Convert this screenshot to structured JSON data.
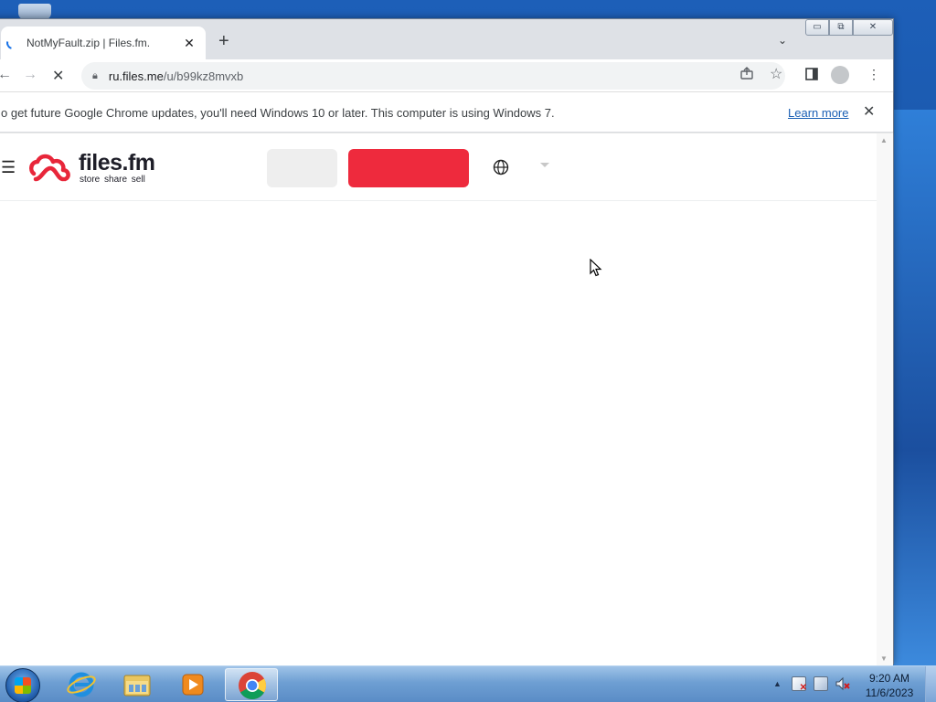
{
  "browser": {
    "tab": {
      "title": "NotMyFault.zip | Files.fm.",
      "close_glyph": "✕"
    },
    "new_tab_glyph": "+",
    "tab_search_glyph": "⌄",
    "window_controls": {
      "minimize": "▭",
      "maximize": "⧉",
      "close": "✕"
    },
    "nav": {
      "back": "←",
      "forward": "→",
      "reload": "✕"
    },
    "omnibox": {
      "host": "ru.files.me",
      "path": "/u/b99kz8mvxb"
    },
    "infobar": {
      "message": "o get future Google Chrome updates, you'll need Windows 10 or later. This computer is using Windows 7.",
      "learn_more": "Learn more",
      "close_glyph": "✕"
    }
  },
  "site": {
    "hamburger": "☰",
    "logo": {
      "name": "files.fm",
      "tagline": "store share sell",
      "brand_color": "#e8263a"
    },
    "buttons": {
      "secondary_color": "#eeeeee",
      "primary_color": "#ee2a3d"
    }
  },
  "taskbar": {
    "apps": [
      "start-button",
      "internet-explorer",
      "windows-explorer",
      "media-player",
      "google-chrome"
    ],
    "active_app": "google-chrome",
    "clock": {
      "time": "9:20 AM",
      "date": "11/6/2023"
    }
  }
}
